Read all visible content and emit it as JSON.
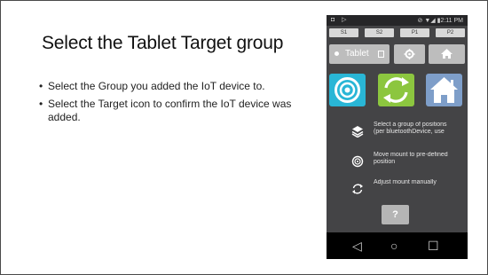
{
  "slide": {
    "title": "Select the Tablet Target group",
    "bullets": [
      "Select the Group you added the IoT device to.",
      "Select the Target icon to confirm the IoT device was added."
    ]
  },
  "phone": {
    "status": {
      "left": "◘ ▷",
      "right": "⊘ ▼◢ ▮2:11 PM"
    },
    "position_buttons": [
      "S1",
      "S2",
      "P1",
      "P2"
    ],
    "top_buttons": {
      "tablet_label": "Tablet"
    },
    "big_buttons": [
      {
        "icon": "target-icon",
        "color": "#29b6d6"
      },
      {
        "icon": "sync-icon",
        "color": "#8cc63f"
      },
      {
        "icon": "home-icon",
        "color": "#7e9ec9"
      }
    ],
    "legend": [
      {
        "icon": "layers-icon",
        "text": "Select a group of positions (per bluetoothDevice, use"
      },
      {
        "icon": "target-icon",
        "text": "Move mount to pre-defined position"
      },
      {
        "icon": "sync-icon",
        "text": "Adjust mount manually"
      }
    ],
    "help_label": "?",
    "nav": [
      "◁",
      "○",
      "☐"
    ]
  },
  "colors": {
    "tablet_button": "#bdbdbd",
    "screen_bg": "#444446",
    "navbar": "#000000"
  }
}
